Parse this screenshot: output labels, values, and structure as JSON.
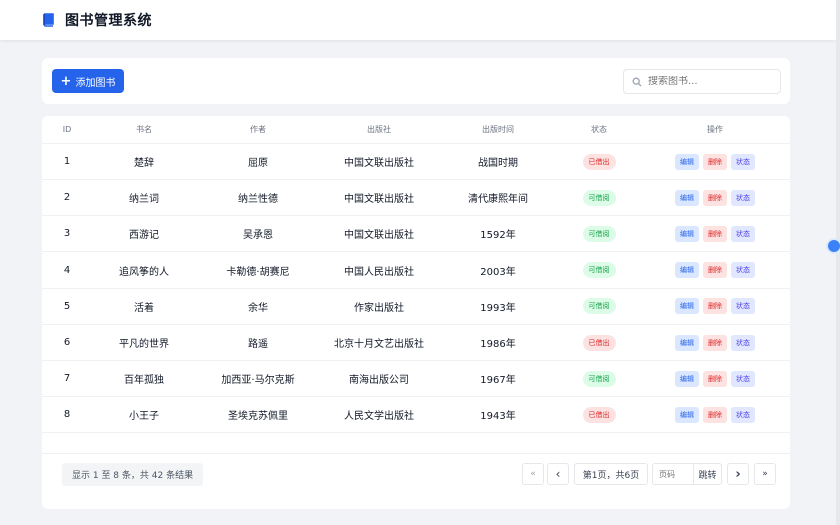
{
  "app": {
    "title": "图书管理系统"
  },
  "toolbar": {
    "add_label": "添加图书",
    "search_placeholder": "搜索图书..."
  },
  "table": {
    "headers": [
      "ID",
      "书名",
      "作者",
      "出版社",
      "出版时间",
      "状态",
      "操作"
    ],
    "rows": [
      {
        "id": "1",
        "name": "楚辞",
        "author": "屈原",
        "publisher": "中国文联出版社",
        "time": "战国时期",
        "status": "已借出",
        "status_type": "out"
      },
      {
        "id": "2",
        "name": "纳兰词",
        "author": "纳兰性德",
        "publisher": "中国文联出版社",
        "time": "清代康熙年间",
        "status": "可借阅",
        "status_type": "in"
      },
      {
        "id": "3",
        "name": "西游记",
        "author": "吴承恩",
        "publisher": "中国文联出版社",
        "time": "1592年",
        "status": "可借阅",
        "status_type": "in"
      },
      {
        "id": "4",
        "name": "追风筝的人",
        "author": "卡勒德·胡赛尼",
        "publisher": "中国人民出版社",
        "time": "2003年",
        "status": "可借阅",
        "status_type": "in"
      },
      {
        "id": "5",
        "name": "活着",
        "author": "余华",
        "publisher": "作家出版社",
        "time": "1993年",
        "status": "可借阅",
        "status_type": "in"
      },
      {
        "id": "6",
        "name": "平凡的世界",
        "author": "路遥",
        "publisher": "北京十月文艺出版社",
        "time": "1986年",
        "status": "已借出",
        "status_type": "out"
      },
      {
        "id": "7",
        "name": "百年孤独",
        "author": "加西亚·马尔克斯",
        "publisher": "南海出版公司",
        "time": "1967年",
        "status": "可借阅",
        "status_type": "in"
      },
      {
        "id": "8",
        "name": "小王子",
        "author": "圣埃克苏佩里",
        "publisher": "人民文学出版社",
        "time": "1943年",
        "status": "已借出",
        "status_type": "out"
      }
    ],
    "actions": {
      "edit": "编辑",
      "delete": "删除",
      "status": "状态"
    }
  },
  "pagination": {
    "summary": "显示 1 至 8 条，共 42 条结果",
    "first": "«",
    "prev": "‹",
    "page_info": "第1页，共6页",
    "page_input_placeholder": "页码",
    "go": "跳转",
    "next": "›",
    "last": "»"
  },
  "colors": {
    "primary": "#2563eb",
    "danger": "#dc2626",
    "success": "#16a34a",
    "background": "#f1f3f6"
  }
}
